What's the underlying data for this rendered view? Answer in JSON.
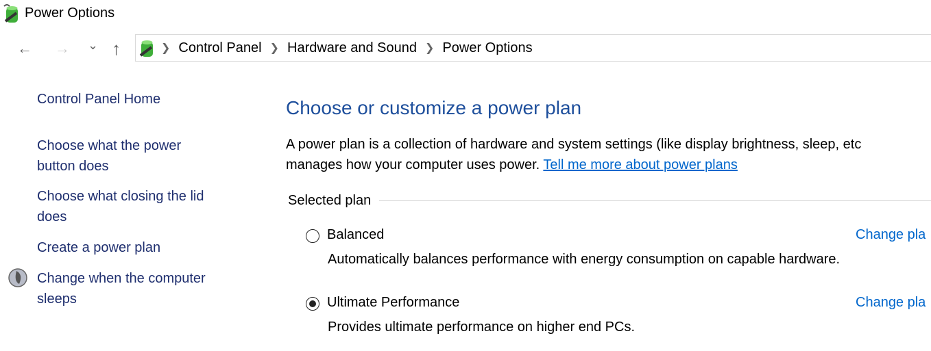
{
  "window": {
    "title": "Power Options",
    "icon": "power-battery-icon"
  },
  "nav": {
    "back": "←",
    "forward": "→",
    "recent": "⌄",
    "up": "↑",
    "breadcrumb": [
      "Control Panel",
      "Hardware and Sound",
      "Power Options"
    ]
  },
  "sidebar": {
    "home": "Control Panel Home",
    "items": [
      {
        "line1": "Choose what the power",
        "line2": "button does"
      },
      {
        "line1": "Choose what closing the lid",
        "line2": "does"
      },
      {
        "line1": "Create a power plan"
      },
      {
        "line1": "Change when the computer",
        "line2": "sleeps",
        "icon": "moon-icon"
      }
    ]
  },
  "main": {
    "heading": "Choose or customize a power plan",
    "desc_line1": "A power plan is a collection of hardware and system settings (like display brightness, sleep, etc",
    "desc_line2": "manages how your computer uses power. ",
    "desc_link": "Tell me more about power plans",
    "group_label": "Selected plan",
    "plans": [
      {
        "name": "Balanced",
        "description": "Automatically balances performance with energy consumption on capable hardware.",
        "selected": false,
        "change_link": "Change pla"
      },
      {
        "name": "Ultimate Performance",
        "description": "Provides ultimate performance on higher end PCs.",
        "selected": true,
        "change_link": "Change pla"
      }
    ]
  },
  "colors": {
    "heading": "#1e4f9c",
    "link": "#0066cc",
    "sidebar_link": "#1e2e6e"
  }
}
